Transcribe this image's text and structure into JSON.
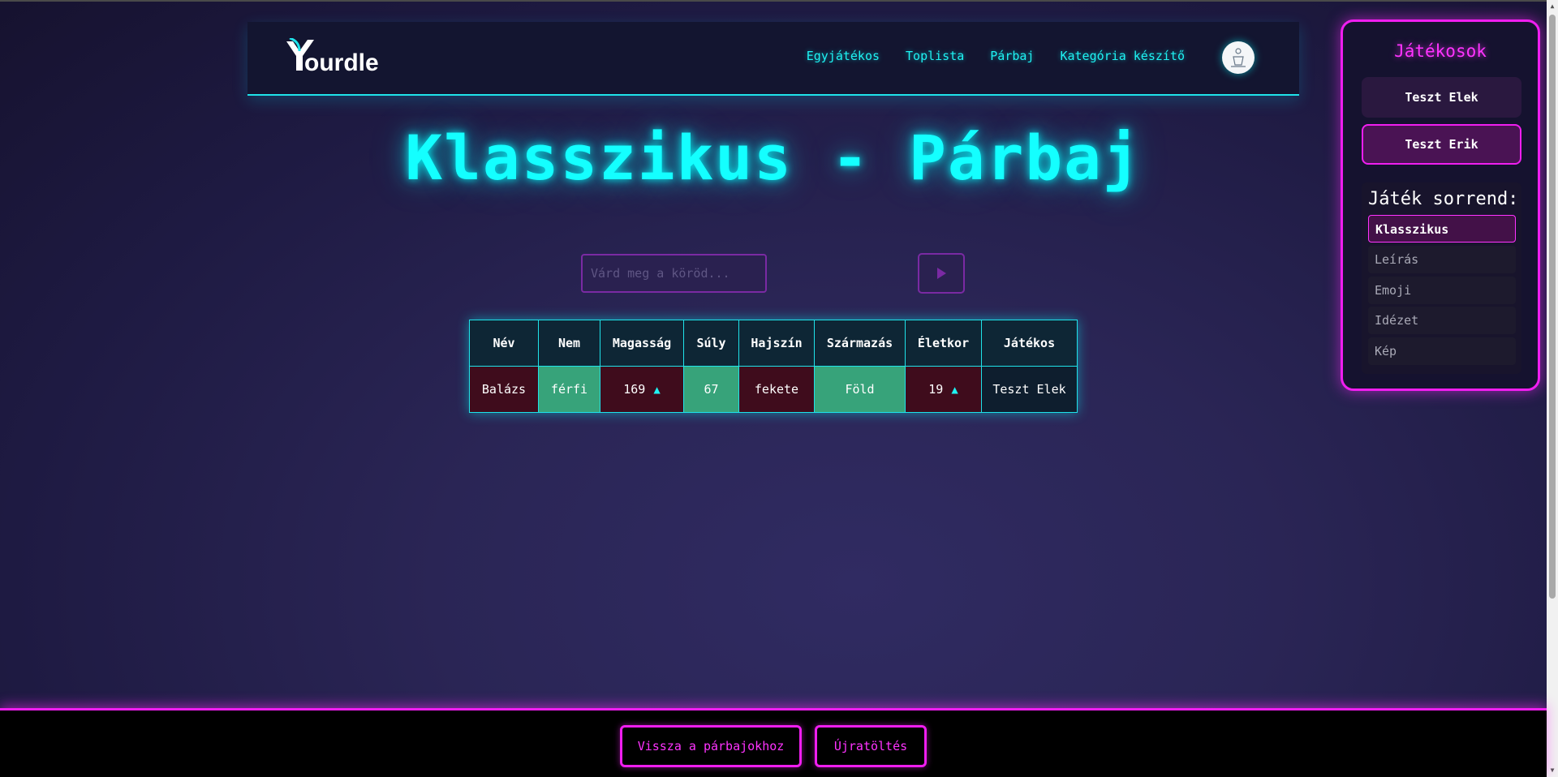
{
  "header": {
    "logo_text": "Yourdle",
    "nav": [
      "Egyjátékos",
      "Toplista",
      "Párbaj",
      "Kategória készítő"
    ]
  },
  "page": {
    "title": "Klasszikus - Párbaj"
  },
  "guess": {
    "placeholder": "Várd meg a köröd..."
  },
  "table": {
    "columns": [
      "Név",
      "Nem",
      "Magasság",
      "Súly",
      "Hajszín",
      "Származás",
      "Életkor",
      "Játékos"
    ],
    "rows": [
      {
        "name": "Balázs",
        "gender": "férfi",
        "height": "169",
        "weight": "67",
        "hair": "fekete",
        "origin": "Föld",
        "age": "19",
        "player": "Teszt Elek"
      }
    ]
  },
  "players_panel": {
    "title": "Játékosok",
    "players": [
      "Teszt Elek",
      "Teszt Erik"
    ],
    "order_title": "Játék sorrend:",
    "order": [
      "Klasszikus",
      "Leírás",
      "Emoji",
      "Idézet",
      "Kép"
    ]
  },
  "footer": {
    "back_label": "Vissza a párbajokhoz",
    "reload_label": "Újratöltés"
  },
  "colors": {
    "neon_cyan": "#14ffff",
    "neon_magenta": "#f01ef0",
    "correct": "#37a37a",
    "wrong": "#3f0c1c"
  },
  "icons": {
    "submit": "play-icon",
    "arrow_up": "arrow-up-icon"
  }
}
